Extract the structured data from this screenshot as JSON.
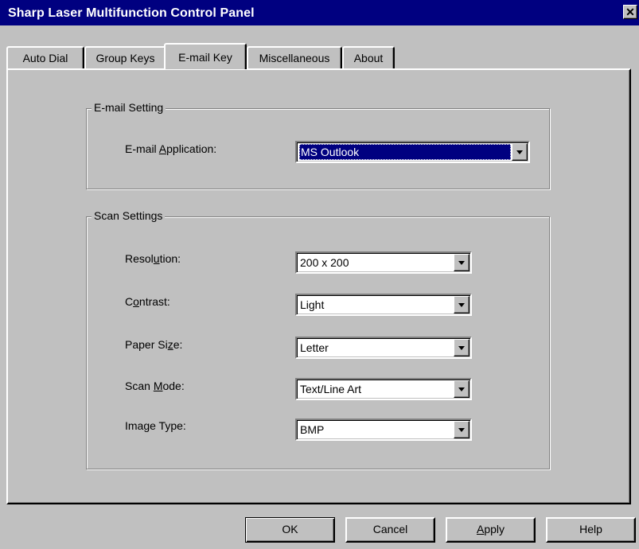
{
  "window": {
    "title": "Sharp Laser Multifunction Control Panel",
    "close_glyph": "✕"
  },
  "tabs": [
    {
      "label": "Auto Dial",
      "active": false
    },
    {
      "label": "Group Keys",
      "active": false
    },
    {
      "label": "E-mail Key",
      "active": true
    },
    {
      "label": "Miscellaneous",
      "active": false
    },
    {
      "label": "About",
      "active": false
    }
  ],
  "email_setting": {
    "group_title": "E-mail Setting",
    "application_label_pre": "E-mail ",
    "application_label_accel": "A",
    "application_label_post": "pplication:",
    "application_value": "MS Outlook"
  },
  "scan_settings": {
    "group_title": "Scan Settings",
    "fields": [
      {
        "label_pre": "Resol",
        "accel": "u",
        "label_post": "tion:",
        "value": "200 x 200"
      },
      {
        "label_pre": "C",
        "accel": "o",
        "label_post": "ntrast:",
        "value": "Light"
      },
      {
        "label_pre": "Paper Si",
        "accel": "z",
        "label_post": "e:",
        "value": "Letter"
      },
      {
        "label_pre": "Scan ",
        "accel": "M",
        "label_post": "ode:",
        "value": "Text/Line Art"
      },
      {
        "label_pre": "Image Type:",
        "accel": "",
        "label_post": "",
        "value": "BMP"
      }
    ]
  },
  "buttons": {
    "ok": "OK",
    "cancel": "Cancel",
    "apply_accel": "A",
    "apply_rest": "pply",
    "help": "Help"
  }
}
